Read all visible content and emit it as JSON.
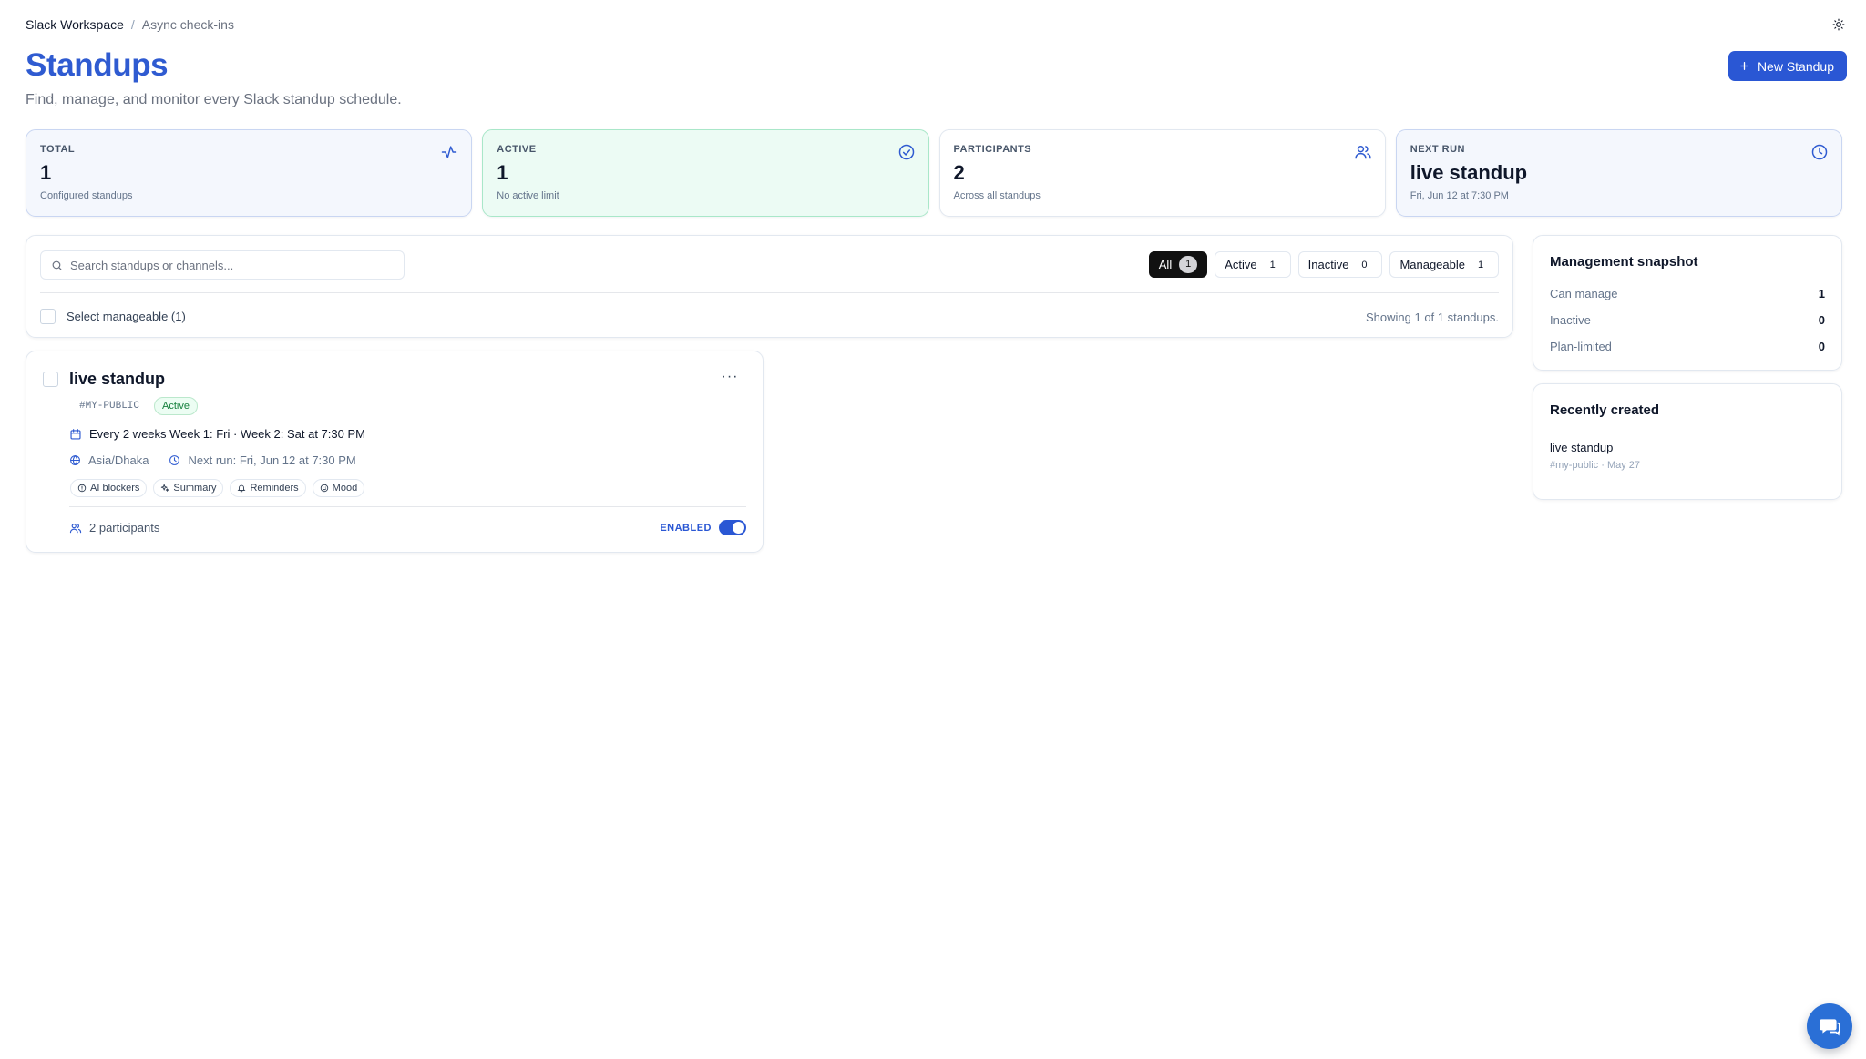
{
  "breadcrumb": {
    "workspace": "Slack Workspace",
    "separator": "/",
    "section": "Async check-ins"
  },
  "header": {
    "title": "Standups",
    "subtitle": "Find, manage, and monitor every Slack standup schedule.",
    "new_button_label": "New Standup"
  },
  "stats": [
    {
      "label": "TOTAL",
      "value": "1",
      "sub": "Configured standups",
      "icon": "activity-icon"
    },
    {
      "label": "ACTIVE",
      "value": "1",
      "sub": "No active limit",
      "icon": "check-circle-icon"
    },
    {
      "label": "PARTICIPANTS",
      "value": "2",
      "sub": "Across all standups",
      "icon": "users-icon"
    },
    {
      "label": "NEXT RUN",
      "value": "live standup",
      "sub": "Fri, Jun 12 at 7:30 PM",
      "icon": "clock-icon"
    }
  ],
  "filters": {
    "search_placeholder": "Search standups or channels...",
    "search_value": "",
    "chips": [
      {
        "label": "All",
        "count": "1",
        "selected": true
      },
      {
        "label": "Active",
        "count": "1",
        "selected": false
      },
      {
        "label": "Inactive",
        "count": "0",
        "selected": false
      },
      {
        "label": "Manageable",
        "count": "1",
        "selected": false
      }
    ],
    "select_label": "Select manageable (1)",
    "showing": "Showing 1 of 1 standups."
  },
  "standup": {
    "title": "live standup",
    "channel": "#MY-PUBLIC",
    "status": "Active",
    "schedule": "Every 2 weeks Week 1: Fri · Week 2: Sat at 7:30 PM",
    "timezone": "Asia/Dhaka",
    "next_run": "Next run: Fri, Jun 12 at 7:30 PM",
    "features": [
      "AI blockers",
      "Summary",
      "Reminders",
      "Mood"
    ],
    "participants": "2 participants",
    "enabled_label": "ENABLED",
    "enabled": true,
    "more_label": "···"
  },
  "snapshot": {
    "title": "Management snapshot",
    "rows": [
      {
        "label": "Can manage",
        "value": "1"
      },
      {
        "label": "Inactive",
        "value": "0"
      },
      {
        "label": "Plan-limited",
        "value": "0"
      }
    ]
  },
  "recent": {
    "title": "Recently created",
    "name": "live standup",
    "meta": "#my-public · May 27"
  },
  "colors": {
    "accent": "#2a57d4",
    "title": "#2f5bd1",
    "active_green": "#15803d"
  }
}
